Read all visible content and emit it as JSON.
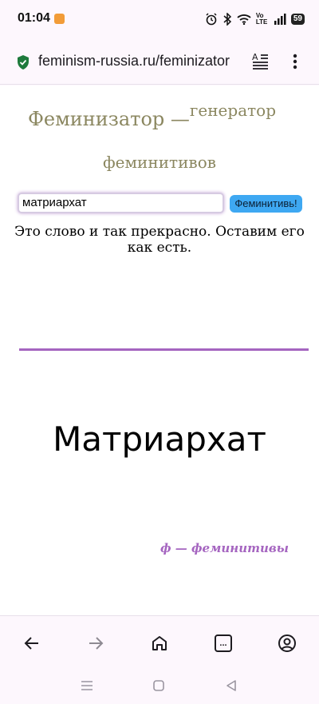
{
  "status_bar": {
    "time": "01:04",
    "lte_label": "Vo LTE",
    "battery": "59"
  },
  "browser": {
    "url": "feminism-russia.ru/feminizator",
    "tabs_count": "..."
  },
  "page": {
    "title_main": "Феминизатор —",
    "title_sup": "генератор",
    "title_line2": "феминитивов",
    "input_value": "матриархат",
    "button_label": "Феминитивь!",
    "result_message": "Это слово и так прекрасно. Оставим его как есть.",
    "big_word": "Матриархат",
    "brand": "ф — феминитивы"
  },
  "colors": {
    "title": "#8b8760",
    "accent_purple": "#a565c0",
    "button": "#3ea8f2",
    "secure_lock": "#1e7a3c"
  }
}
